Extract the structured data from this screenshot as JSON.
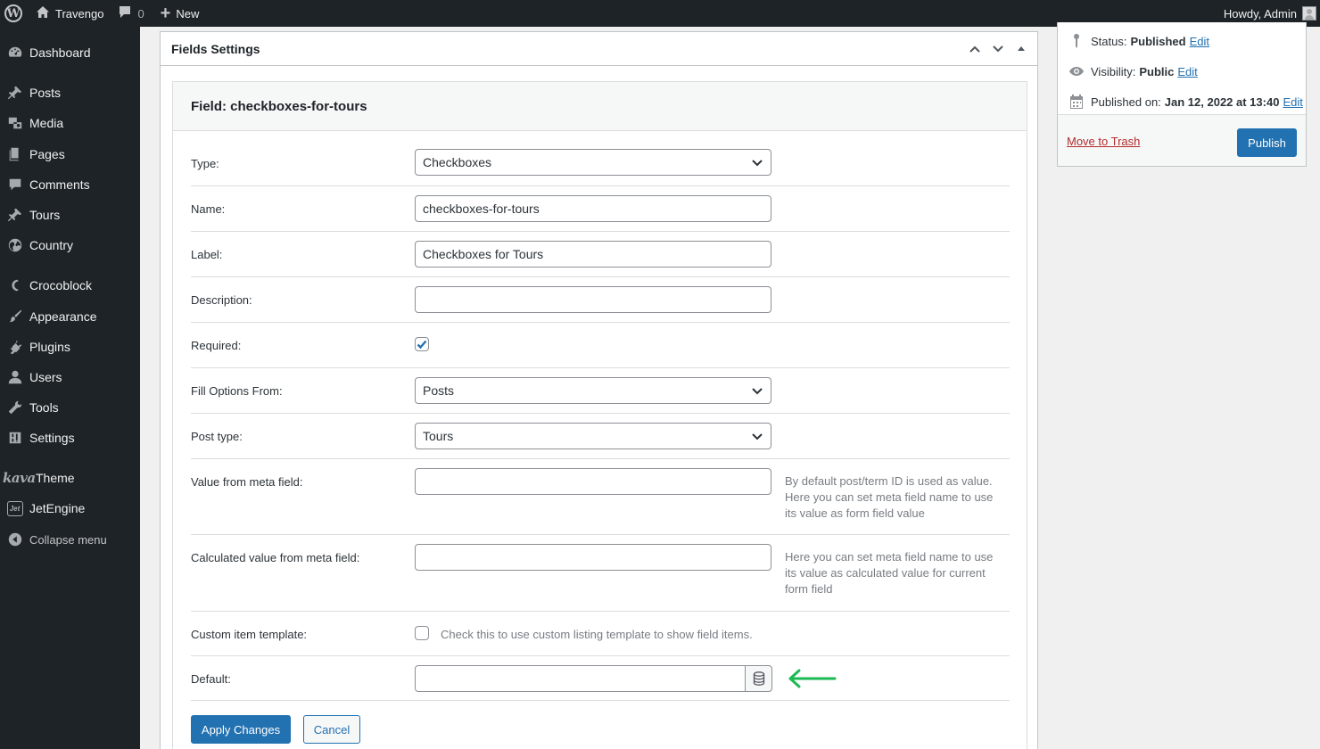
{
  "admin_bar": {
    "site_name": "Travengo",
    "comments_count": "0",
    "new_label": "New",
    "greeting": "Howdy, Admin"
  },
  "sidebar": {
    "items": [
      {
        "label": "Dashboard",
        "icon": "dashboard-icon"
      },
      {
        "label": "Posts",
        "icon": "pin-icon"
      },
      {
        "label": "Media",
        "icon": "media-icon"
      },
      {
        "label": "Pages",
        "icon": "pages-icon"
      },
      {
        "label": "Comments",
        "icon": "comment-icon"
      },
      {
        "label": "Tours",
        "icon": "pin-icon"
      },
      {
        "label": "Country",
        "icon": "globe-icon"
      },
      {
        "label": "Crocoblock",
        "icon": "crocoblock-icon"
      },
      {
        "label": "Appearance",
        "icon": "brush-icon"
      },
      {
        "label": "Plugins",
        "icon": "plugin-icon"
      },
      {
        "label": "Users",
        "icon": "user-icon"
      },
      {
        "label": "Tools",
        "icon": "wrench-icon"
      },
      {
        "label": "Settings",
        "icon": "settings-icon"
      },
      {
        "label": "Theme",
        "logo_text": "kava"
      },
      {
        "label": "JetEngine",
        "icon_text": "Jet"
      },
      {
        "label": "Collapse menu",
        "icon": "collapse-icon"
      }
    ]
  },
  "fields_box": {
    "title": "Fields Settings",
    "field_title": "Field: checkboxes-for-tours",
    "rows": {
      "type": {
        "label": "Type:",
        "value": "Checkboxes"
      },
      "name": {
        "label": "Name:",
        "value": "checkboxes-for-tours"
      },
      "label": {
        "label": "Label:",
        "value": "Checkboxes for Tours"
      },
      "description": {
        "label": "Description:",
        "value": ""
      },
      "required": {
        "label": "Required:",
        "checked": true
      },
      "fill_options": {
        "label": "Fill Options From:",
        "value": "Posts"
      },
      "post_type": {
        "label": "Post type:",
        "value": "Tours"
      },
      "value_meta": {
        "label": "Value from meta field:",
        "value": "",
        "description": "By default post/term ID is used as value. Here you can set meta field name to use its value as form field value"
      },
      "calc_meta": {
        "label": "Calculated value from meta field:",
        "value": "",
        "description": "Here you can set meta field name to use its value as calculated value for current form field"
      },
      "custom_template": {
        "label": "Custom item template:",
        "checked": false,
        "hint": "Check this to use custom listing template to show field items."
      },
      "default": {
        "label": "Default:",
        "value": ""
      }
    },
    "apply_label": "Apply Changes",
    "cancel_label": "Cancel",
    "arrow_color": "#1db954"
  },
  "publish": {
    "status_label": "Status:",
    "status_value": "Published",
    "visibility_label": "Visibility:",
    "visibility_value": "Public",
    "published_label": "Published on:",
    "published_value": "Jan 12, 2022 at 13:40",
    "edit_label": "Edit",
    "trash_label": "Move to Trash",
    "publish_label": "Publish"
  }
}
